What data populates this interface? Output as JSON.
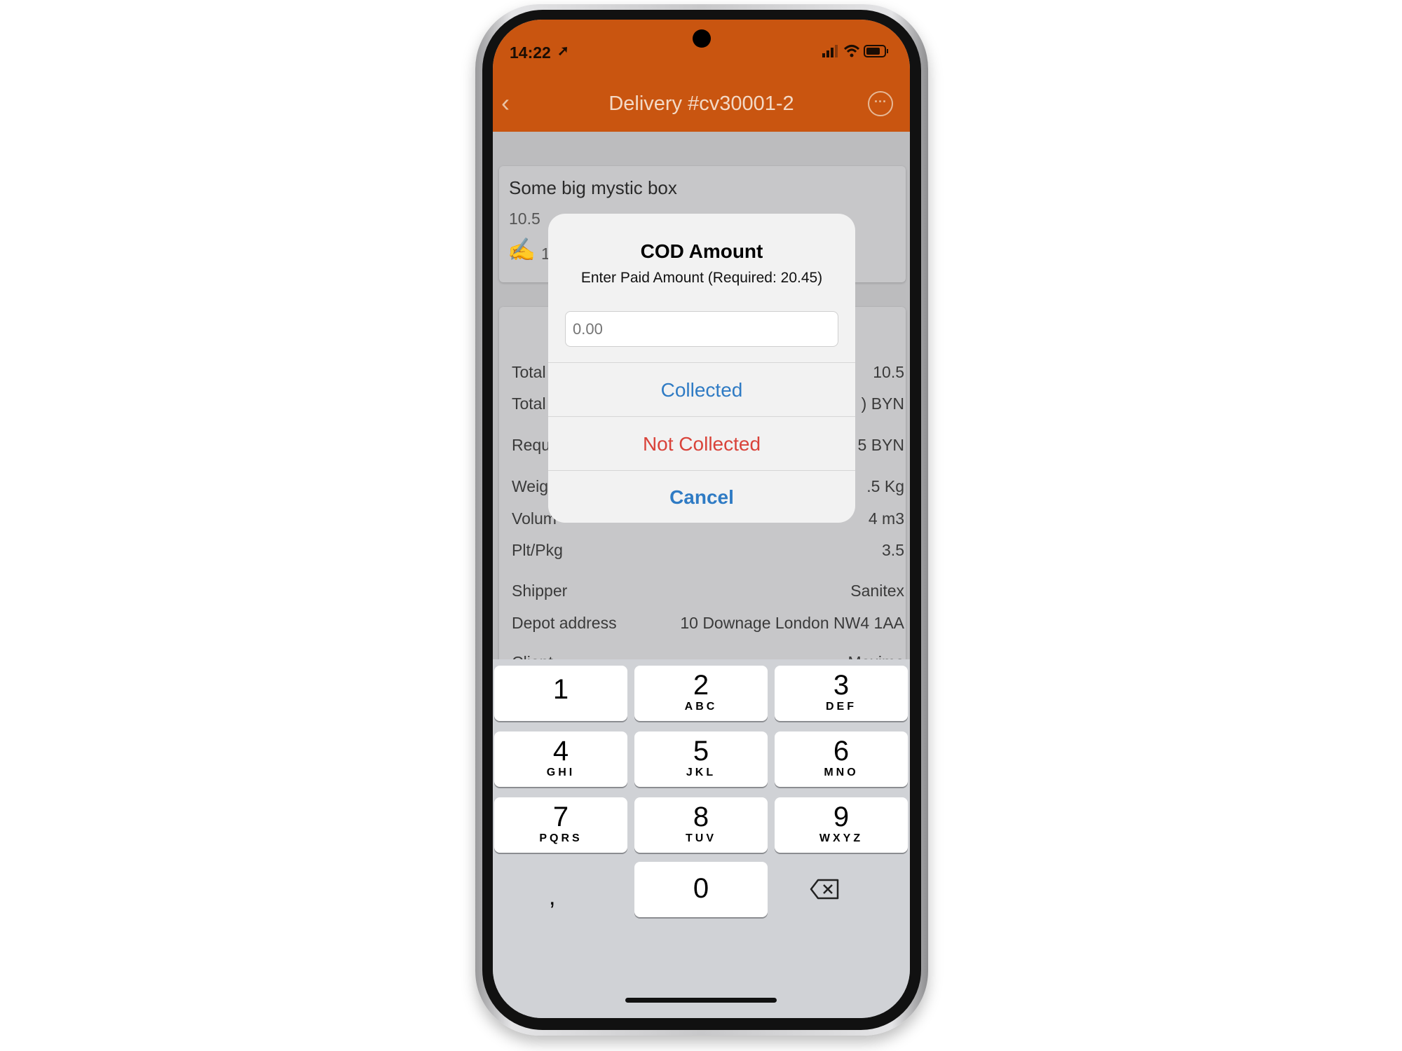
{
  "status_bar": {
    "time": "14:22"
  },
  "header": {
    "title": "Delivery #cv30001-2",
    "accent": "#c95510"
  },
  "card": {
    "name": "Some big mystic box",
    "qty": "10.5",
    "cod_partial": "1"
  },
  "details": [
    {
      "label": "Total I",
      "value": "10.5"
    },
    {
      "label": "Total",
      "value": ") BYN"
    },
    {
      "label": "Requi",
      "value": "5 BYN"
    },
    {
      "label": "Weigh",
      "value": ".5 Kg"
    },
    {
      "label": "Volum",
      "value": "4 m3"
    },
    {
      "label": "Plt/Pkg",
      "value": "3.5"
    },
    {
      "label": "Shipper",
      "value": "Sanitex"
    },
    {
      "label": "Depot address",
      "value": "10 Downage London NW4 1AA"
    },
    {
      "label": "Client",
      "value": "Maxima"
    }
  ],
  "dialog": {
    "title": "COD Amount",
    "message": "Enter Paid Amount (Required: 20.45)",
    "input_placeholder": "0.00",
    "collected": "Collected",
    "not_collected": "Not Collected",
    "cancel": "Cancel",
    "blue": "#2f7bc4",
    "red": "#d9433a"
  },
  "keyboard": {
    "keys": [
      {
        "n": "1",
        "l": ""
      },
      {
        "n": "2",
        "l": "ABC"
      },
      {
        "n": "3",
        "l": "DEF"
      },
      {
        "n": "4",
        "l": "GHI"
      },
      {
        "n": "5",
        "l": "JKL"
      },
      {
        "n": "6",
        "l": "MNO"
      },
      {
        "n": "7",
        "l": "PQRS"
      },
      {
        "n": "8",
        "l": "TUV"
      },
      {
        "n": "9",
        "l": "WXYZ"
      }
    ],
    "zero": "0",
    "comma": ","
  }
}
